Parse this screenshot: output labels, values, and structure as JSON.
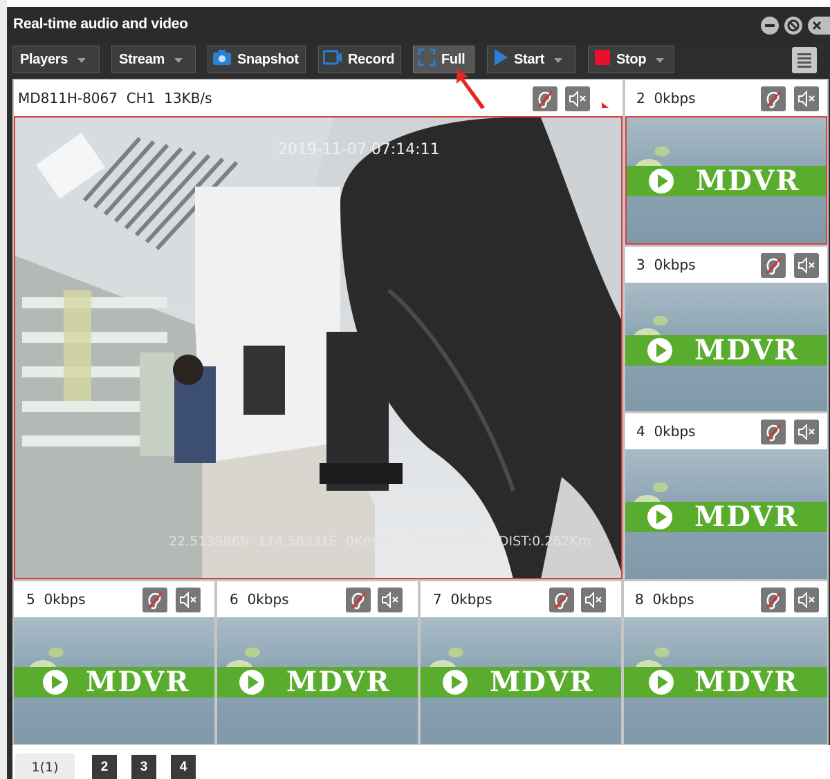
{
  "window": {
    "title": "Real-time audio and video",
    "controls": [
      "minimize-icon",
      "restore-icon",
      "close-icon"
    ]
  },
  "toolbar": {
    "players_label": "Players",
    "stream_label": "Stream",
    "snapshot_label": "Snapshot",
    "record_label": "Record",
    "full_label": "Full",
    "start_label": "Start",
    "stop_label": "Stop"
  },
  "main_channel": {
    "header": "MD811H-8067  CH1  13KB/s",
    "timestamp": "2019-11-07 07:14:11",
    "info": "22.513986N  114.58331E  0Km/H      TIME:4:03H  DIST:0.262Km"
  },
  "channels": [
    {
      "label": "2  0kbps"
    },
    {
      "label": "3  0kbps"
    },
    {
      "label": "4  0kbps"
    },
    {
      "label": "5  0kbps"
    },
    {
      "label": "6  0kbps"
    },
    {
      "label": "7  0kbps"
    },
    {
      "label": "8  0kbps"
    }
  ],
  "placeholder_logo": "MDVR",
  "pager": {
    "current": "1(1)",
    "pages": [
      "2",
      "3",
      "4"
    ]
  },
  "colors": {
    "accent_red": "#e02a2a",
    "logo_green": "#5aac2e",
    "window_dark": "#2d2d2d"
  }
}
